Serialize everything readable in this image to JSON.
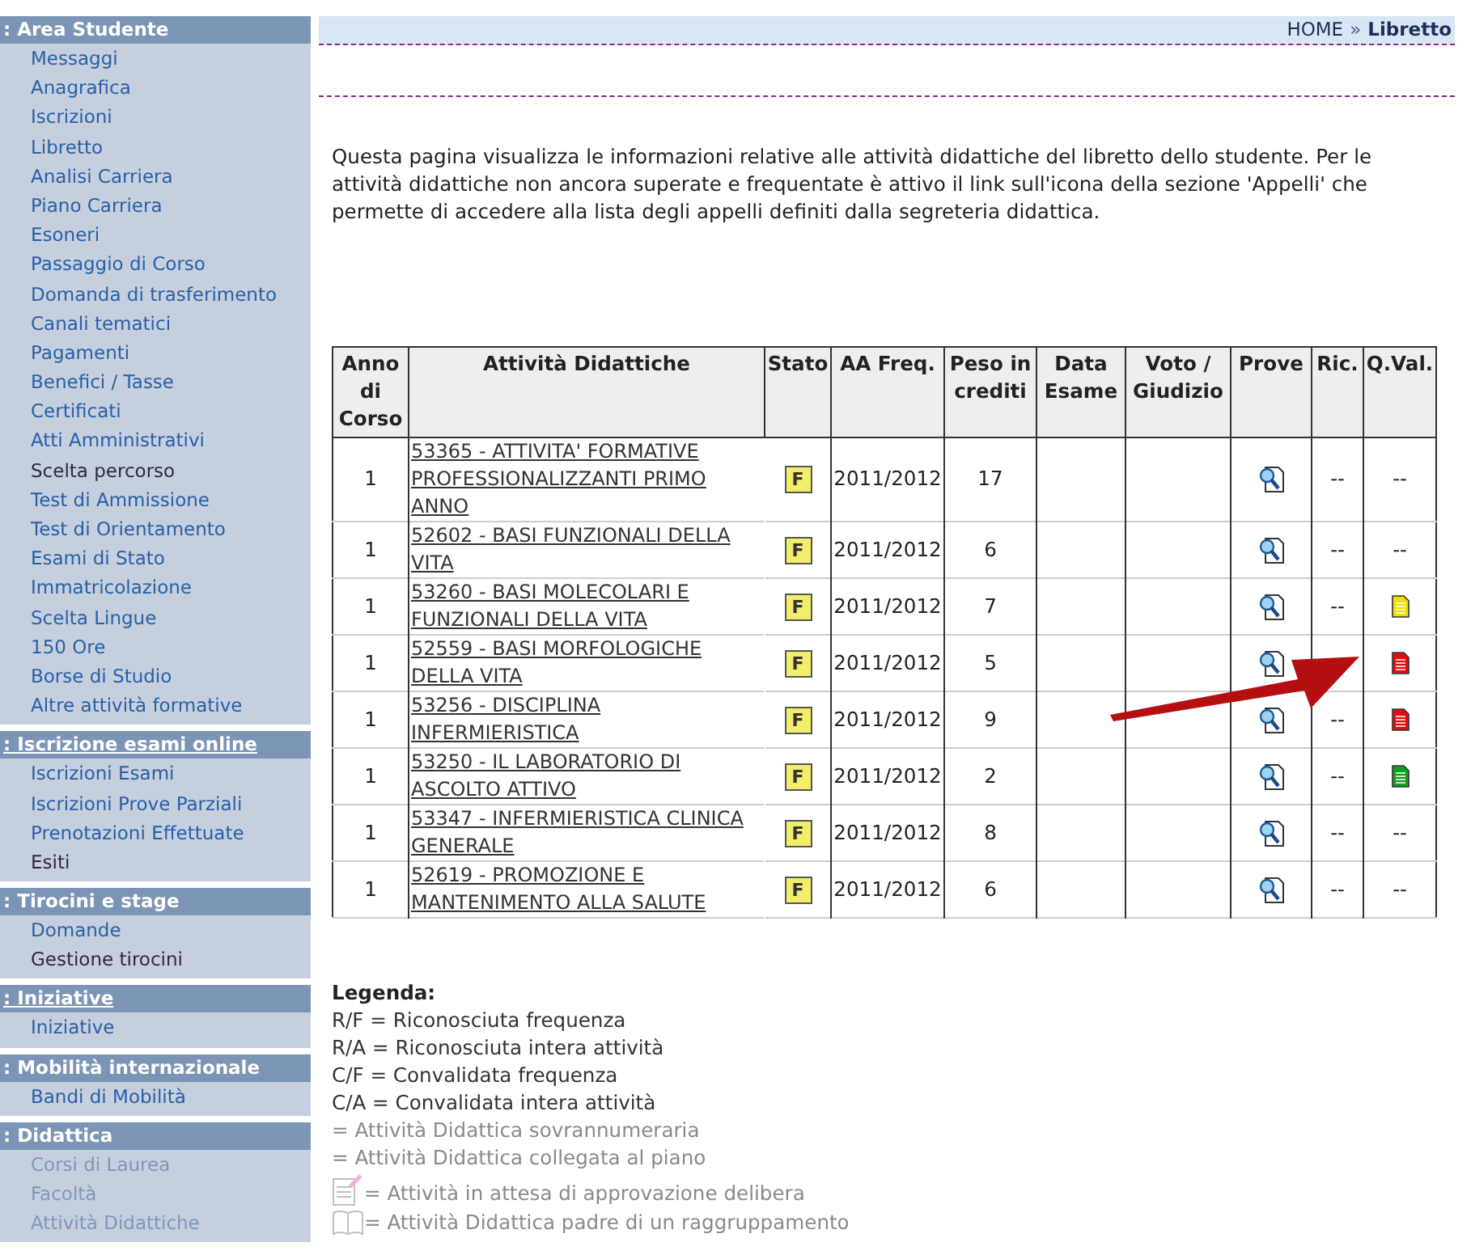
{
  "sidebar": {
    "sections": [
      {
        "title": ": Area Studente",
        "link": false,
        "items": [
          {
            "label": "Messaggi",
            "visited": false,
            "faded": false
          },
          {
            "label": "Anagrafica",
            "visited": false,
            "faded": false
          },
          {
            "label": "Iscrizioni",
            "visited": false,
            "faded": false
          },
          {
            "label": "Libretto",
            "visited": false,
            "faded": false
          },
          {
            "label": "Analisi Carriera",
            "visited": false,
            "faded": false
          },
          {
            "label": "Piano Carriera",
            "visited": false,
            "faded": false
          },
          {
            "label": "Esoneri",
            "visited": false,
            "faded": false
          },
          {
            "label": "Passaggio di Corso",
            "visited": false,
            "faded": false
          },
          {
            "label": "Domanda di trasferimento",
            "visited": false,
            "faded": false
          },
          {
            "label": "Canali tematici",
            "visited": false,
            "faded": false
          },
          {
            "label": "Pagamenti",
            "visited": false,
            "faded": false
          },
          {
            "label": "Benefici / Tasse",
            "visited": false,
            "faded": false
          },
          {
            "label": "Certificati",
            "visited": false,
            "faded": false
          },
          {
            "label": "Atti Amministrativi",
            "visited": false,
            "faded": false
          },
          {
            "label": "Scelta percorso",
            "visited": true,
            "faded": false
          },
          {
            "label": "Test di Ammissione",
            "visited": false,
            "faded": false
          },
          {
            "label": "Test di Orientamento",
            "visited": false,
            "faded": false
          },
          {
            "label": "Esami di Stato",
            "visited": false,
            "faded": false
          },
          {
            "label": "Immatricolazione",
            "visited": false,
            "faded": false
          },
          {
            "label": "Scelta Lingue",
            "visited": false,
            "faded": false
          },
          {
            "label": "150 Ore",
            "visited": false,
            "faded": false
          },
          {
            "label": "Borse di Studio",
            "visited": false,
            "faded": false
          },
          {
            "label": "Altre attività formative",
            "visited": false,
            "faded": false
          }
        ]
      },
      {
        "title": ": Iscrizione esami online",
        "link": true,
        "items": [
          {
            "label": "Iscrizioni Esami",
            "visited": false,
            "faded": false
          },
          {
            "label": "Iscrizioni Prove Parziali",
            "visited": false,
            "faded": false
          },
          {
            "label": "Prenotazioni Effettuate",
            "visited": false,
            "faded": false
          },
          {
            "label": "Esiti",
            "visited": true,
            "faded": false
          }
        ]
      },
      {
        "title": ": Tirocini e stage",
        "link": false,
        "items": [
          {
            "label": "Domande",
            "visited": false,
            "faded": false
          },
          {
            "label": "Gestione tirocini",
            "visited": true,
            "faded": false
          }
        ]
      },
      {
        "title": ": Iniziative",
        "link": true,
        "items": [
          {
            "label": "Iniziative",
            "visited": false,
            "faded": false
          }
        ]
      },
      {
        "title": ": Mobilità internazionale",
        "link": false,
        "items": [
          {
            "label": "Bandi di Mobilità",
            "visited": false,
            "faded": false
          }
        ]
      },
      {
        "title": ": Didattica",
        "link": false,
        "items": [
          {
            "label": "Corsi di Laurea",
            "visited": false,
            "faded": true
          },
          {
            "label": "Facoltà",
            "visited": false,
            "faded": true
          },
          {
            "label": "Attività Didattiche",
            "visited": false,
            "faded": true
          }
        ]
      }
    ]
  },
  "breadcrumb": {
    "home": "HOME",
    "separator": "»",
    "current": "Libretto"
  },
  "intro": "Questa pagina visualizza le informazioni relative alle attività didattiche del libretto dello studente. Per le attività didattiche non ancora superate e frequentate è attivo il link sull'icona della sezione 'Appelli' che permette di accedere alla lista degli appelli definiti dalla segreteria didattica.",
  "table": {
    "columns": [
      "Anno di Corso",
      "Attività Didattiche",
      "Stato",
      "AA Freq.",
      "Peso in crediti",
      "Data Esame",
      "Voto / Giudizio",
      "Prove",
      "Ric.",
      "Q.Val."
    ],
    "rows": [
      {
        "anno": "1",
        "attivita": "53365 - ATTIVITA' FORMATIVE PROFESSIONALIZZANTI PRIMO ANNO",
        "stato": "F",
        "aa": "2011/2012",
        "peso": "17",
        "ric": "--",
        "qval": {
          "kind": "text",
          "text": "--"
        }
      },
      {
        "anno": "1",
        "attivita": "52602 - BASI FUNZIONALI DELLA VITA",
        "stato": "F",
        "aa": "2011/2012",
        "peso": "6",
        "ric": "--",
        "qval": {
          "kind": "text",
          "text": "--"
        }
      },
      {
        "anno": "1",
        "attivita": "53260 - BASI MOLECOLARI E FUNZIONALI DELLA VITA",
        "stato": "F",
        "aa": "2011/2012",
        "peso": "7",
        "ric": "--",
        "qval": {
          "kind": "doc",
          "color": "#f0e000"
        }
      },
      {
        "anno": "1",
        "attivita": "52559 - BASI MORFOLOGICHE DELLA VITA",
        "stato": "F",
        "aa": "2011/2012",
        "peso": "5",
        "qval": {
          "kind": "doc",
          "color": "#e01010"
        }
      },
      {
        "anno": "1",
        "attivita": "53256 - DISCIPLINA INFERMIERISTICA",
        "stato": "F",
        "aa": "2011/2012",
        "peso": "9",
        "ric": "--",
        "qval": {
          "kind": "doc",
          "color": "#e01010"
        }
      },
      {
        "anno": "1",
        "attivita": "53250 - IL LABORATORIO DI ASCOLTO ATTIVO",
        "stato": "F",
        "aa": "2011/2012",
        "peso": "2",
        "ric": "--",
        "qval": {
          "kind": "doc",
          "color": "#10a020"
        }
      },
      {
        "anno": "1",
        "attivita": "53347 - INFERMIERISTICA CLINICA GENERALE",
        "stato": "F",
        "aa": "2011/2012",
        "peso": "8",
        "ric": "--",
        "qval": {
          "kind": "text",
          "text": "--"
        }
      },
      {
        "anno": "1",
        "attivita": "52619 - PROMOZIONE E MANTENIMENTO ALLA SALUTE",
        "stato": "F",
        "aa": "2011/2012",
        "peso": "6",
        "ric": "--",
        "qval": {
          "kind": "text",
          "text": "--"
        }
      }
    ]
  },
  "legend": {
    "title": "Legenda:",
    "items": [
      {
        "kind": "text",
        "text": "R/F = Riconosciuta frequenza",
        "faded": false
      },
      {
        "kind": "text",
        "text": "R/A = Riconosciuta intera attività",
        "faded": false
      },
      {
        "kind": "text",
        "text": "C/F = Convalidata frequenza",
        "faded": false
      },
      {
        "kind": "text",
        "text": "C/A = Convalidata intera attività",
        "faded": false
      },
      {
        "kind": "text",
        "text": "= Attività Didattica sovrannumeraria",
        "faded": true
      },
      {
        "kind": "text",
        "text": "= Attività Didattica collegata al piano",
        "faded": true
      },
      {
        "kind": "pending",
        "text": "= Attività in attesa di approvazione delibera",
        "faded": true
      },
      {
        "kind": "book",
        "text": "= Attività Didattica padre di un raggruppamento",
        "faded": true
      }
    ]
  }
}
